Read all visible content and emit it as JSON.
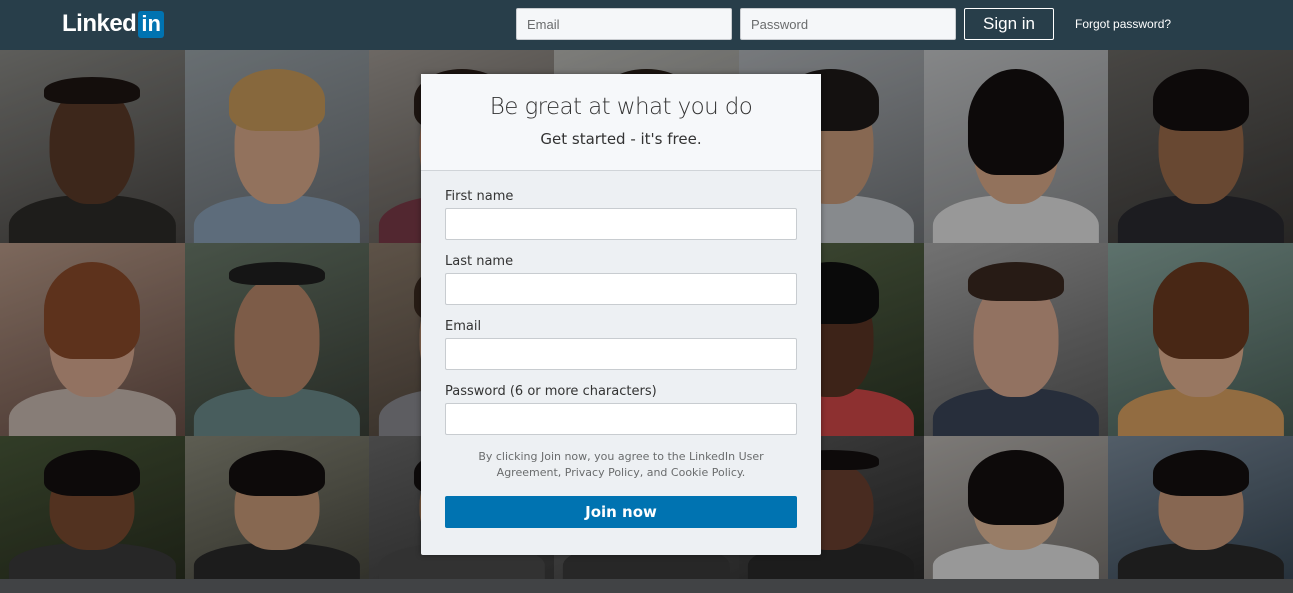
{
  "header": {
    "logo_text": "Linked",
    "logo_badge": "in",
    "email_placeholder": "Email",
    "password_placeholder": "Password",
    "signin_label": "Sign in",
    "forgot_label": "Forgot password?"
  },
  "signup": {
    "headline": "Be great at what you do",
    "subheadline": "Get started - it's free.",
    "fields": [
      {
        "label": "First name",
        "value": ""
      },
      {
        "label": "Last name",
        "value": ""
      },
      {
        "label": "Email",
        "value": ""
      },
      {
        "label": "Password (6 or more characters)",
        "value": ""
      }
    ],
    "terms_text": "By clicking Join now, you agree to the LinkedIn User Agreement, Privacy Policy, and Cookie Policy.",
    "join_label": "Join now"
  },
  "colors": {
    "topbar": "#283e4a",
    "brand_blue": "#0073b1",
    "card_bg": "#edf0f3"
  }
}
